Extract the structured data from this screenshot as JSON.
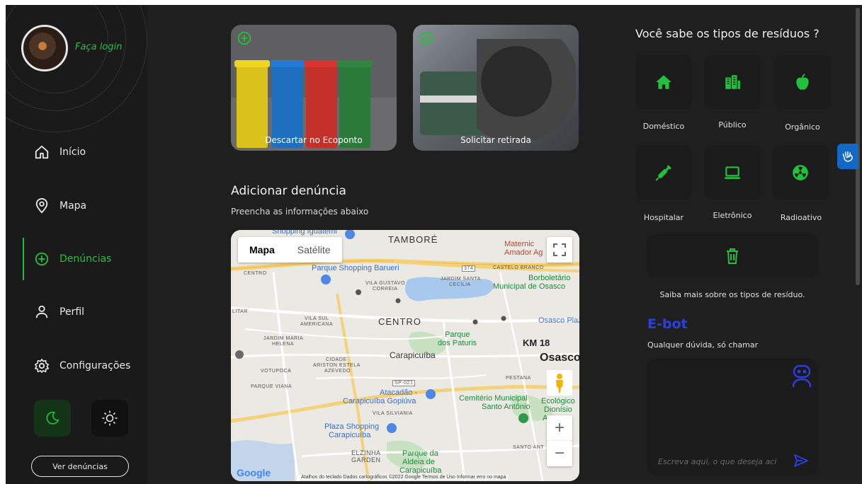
{
  "sidebar": {
    "login_label": "Faça login",
    "nav": [
      {
        "label": "Início",
        "icon": "home-icon"
      },
      {
        "label": "Mapa",
        "icon": "map-pin-icon"
      },
      {
        "label": "Denúncias",
        "icon": "plus-circle-icon",
        "active": true
      },
      {
        "label": "Perfil",
        "icon": "user-icon"
      },
      {
        "label": "Configurações",
        "icon": "gear-icon"
      }
    ],
    "ver_denuncias_label": "Ver denúncias"
  },
  "cards": [
    {
      "caption": "Descartar no Ecoponto"
    },
    {
      "caption": "Solicitar retirada"
    }
  ],
  "report": {
    "title": "Adicionar denúncia",
    "subtitle": "Preencha as informações abaixo"
  },
  "map": {
    "type_map": "Mapa",
    "type_satellite": "Satélite",
    "labels": {
      "shopping_iguatemi": "Shopping Iguatemi",
      "tambore": "TAMBORÉ",
      "maternidade": "Maternic",
      "amador": "Amador Ag",
      "centro_w": "CENTRO",
      "parque_shopping": "Parque Shopping Barueri",
      "road_374": "374",
      "castelo_branco": "CASTELO BRANCO",
      "jardim_santa": "JARDIM SANTA",
      "cecilia": "CECÍLIA",
      "borboletario": "Borboletário",
      "municipal_osasco": "Municipal de Osasco",
      "vila_gustavo": "VILA GUSTAVO",
      "correia": "CORREIA",
      "litar": "LITAR",
      "vila_sul": "VILA SUL",
      "americana": "AMERICANA",
      "centro": "CENTRO",
      "osasco_plaza": "Osasco Plaz",
      "parque": "Parque",
      "dos_paturis": "dos Paturis",
      "km18": "KM 18",
      "jardim_maria": "JARDIM MARIA",
      "helena": "HELENA",
      "carapicuiba": "Carapicuíba",
      "osasco": "Osasco",
      "cidade": "CIDADE",
      "ariston": "ARISTON ESTELA",
      "azevedo": "AZEVEDO",
      "votupoca": "VOTUPOCA",
      "pestana": "PESTANA",
      "parque_viana": "PARQUE VIANA",
      "sp021": "SP-021",
      "atacadao": "Atacadão -",
      "carapicuiba_gopiuva": "Carapicuíba Gopiúva",
      "cemiterio": "Cemitério Municipal",
      "santo_antonio": "Santo Antônio",
      "ecologico": "Ecológico",
      "dionisio": "Dionísio",
      "a_label": "A",
      "vila_silviania": "VILA SILVIANIA",
      "plaza_shopping": "Plaza Shopping",
      "plaza_carapicuiba": "Carapicuíba",
      "santo_ant": "SANTO ANT",
      "elzinha": "ELZINHA",
      "garden": "GARDEN",
      "parque_da": "Parque da",
      "aldeia_de": "Aldeia de",
      "carapicuiba_bottom": "Carapicuíba"
    },
    "google": "Google",
    "footer": "Atalhos do teclado   Dados cartográficos ©2022 Google   Termos de Uso   Informar erro no mapa"
  },
  "waste": {
    "title": "Você sabe os tipos de resíduos ?",
    "types": [
      {
        "label": "Doméstico",
        "icon": "house-icon"
      },
      {
        "label": "Público",
        "icon": "buildings-icon"
      },
      {
        "label": "Orgânico",
        "icon": "apple-icon"
      },
      {
        "label": "Hospitalar",
        "icon": "syringe-icon"
      },
      {
        "label": "Eletrônico",
        "icon": "laptop-icon"
      },
      {
        "label": "Radioativo",
        "icon": "radiation-icon"
      }
    ],
    "more_info": "Saiba mais sobre os tipos de resíduo."
  },
  "ebot": {
    "title": "E-bot",
    "subtitle": "Qualquer dúvida, só chamar",
    "placeholder": "Escreva aqui, o que deseja aci"
  },
  "colors": {
    "accent_green": "#21c23b",
    "ebot_blue": "#2b3fe0",
    "background": "#1f1f1f"
  }
}
